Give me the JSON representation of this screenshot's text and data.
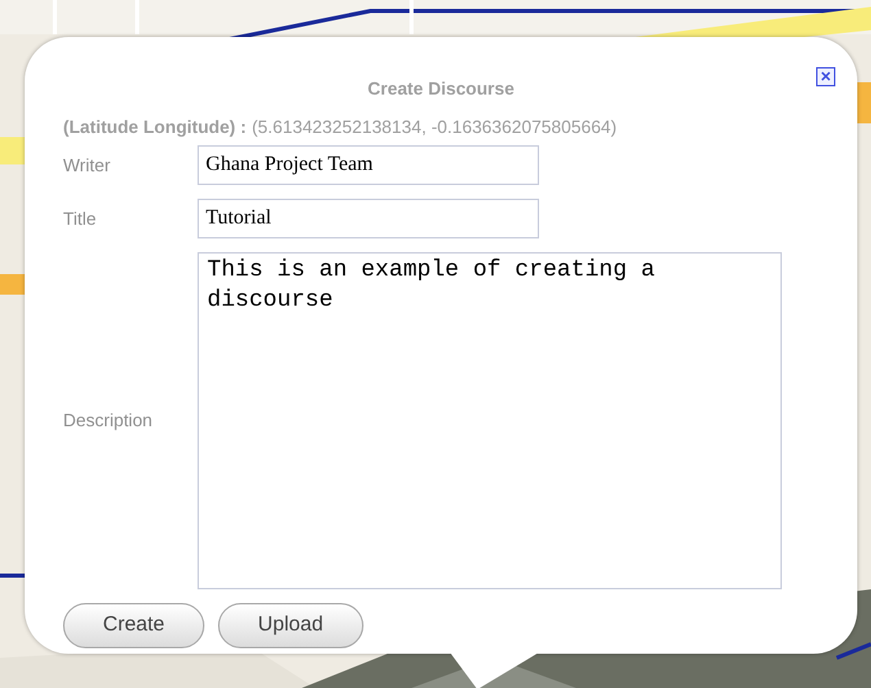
{
  "dialog": {
    "title": "Create Discourse",
    "close": "×",
    "coordinates": {
      "label": "(Latitude Longitude) :",
      "value": "(5.613423252138134, -0.1636362075805664)"
    },
    "fields": [
      {
        "label": "Writer",
        "value": "Ghana Project Team",
        "kind": "text"
      },
      {
        "label": "Title",
        "value": "Tutorial",
        "kind": "text"
      },
      {
        "label": "Description",
        "value": "This is an example of creating a discourse",
        "kind": "textarea"
      }
    ],
    "buttons": [
      "Create",
      "Upload"
    ]
  }
}
